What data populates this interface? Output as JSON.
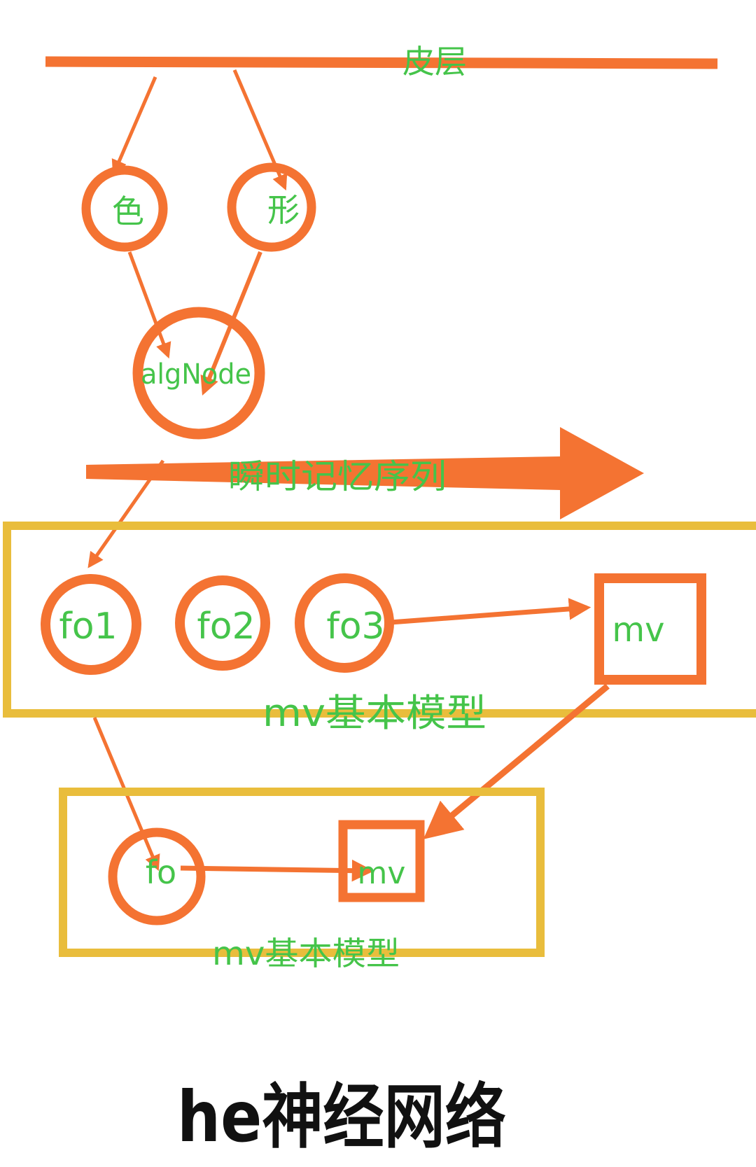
{
  "labels": {
    "cortex": "皮层",
    "color": "色",
    "shape": "形",
    "alg_node": "algNode",
    "memory_sequence": "瞬时记忆序列",
    "fo1": "fo1",
    "fo2": "fo2",
    "fo3": "fo3",
    "mv_top": "mv",
    "model_top": "mv基本模型",
    "fo": "fo",
    "mv_bottom": "mv",
    "model_bottom": "mv基本模型"
  },
  "title": "he神经网络",
  "colors": {
    "arrow": "#f47332",
    "frame": "#e9bd3c",
    "label": "#45c44a",
    "title": "#111111"
  }
}
